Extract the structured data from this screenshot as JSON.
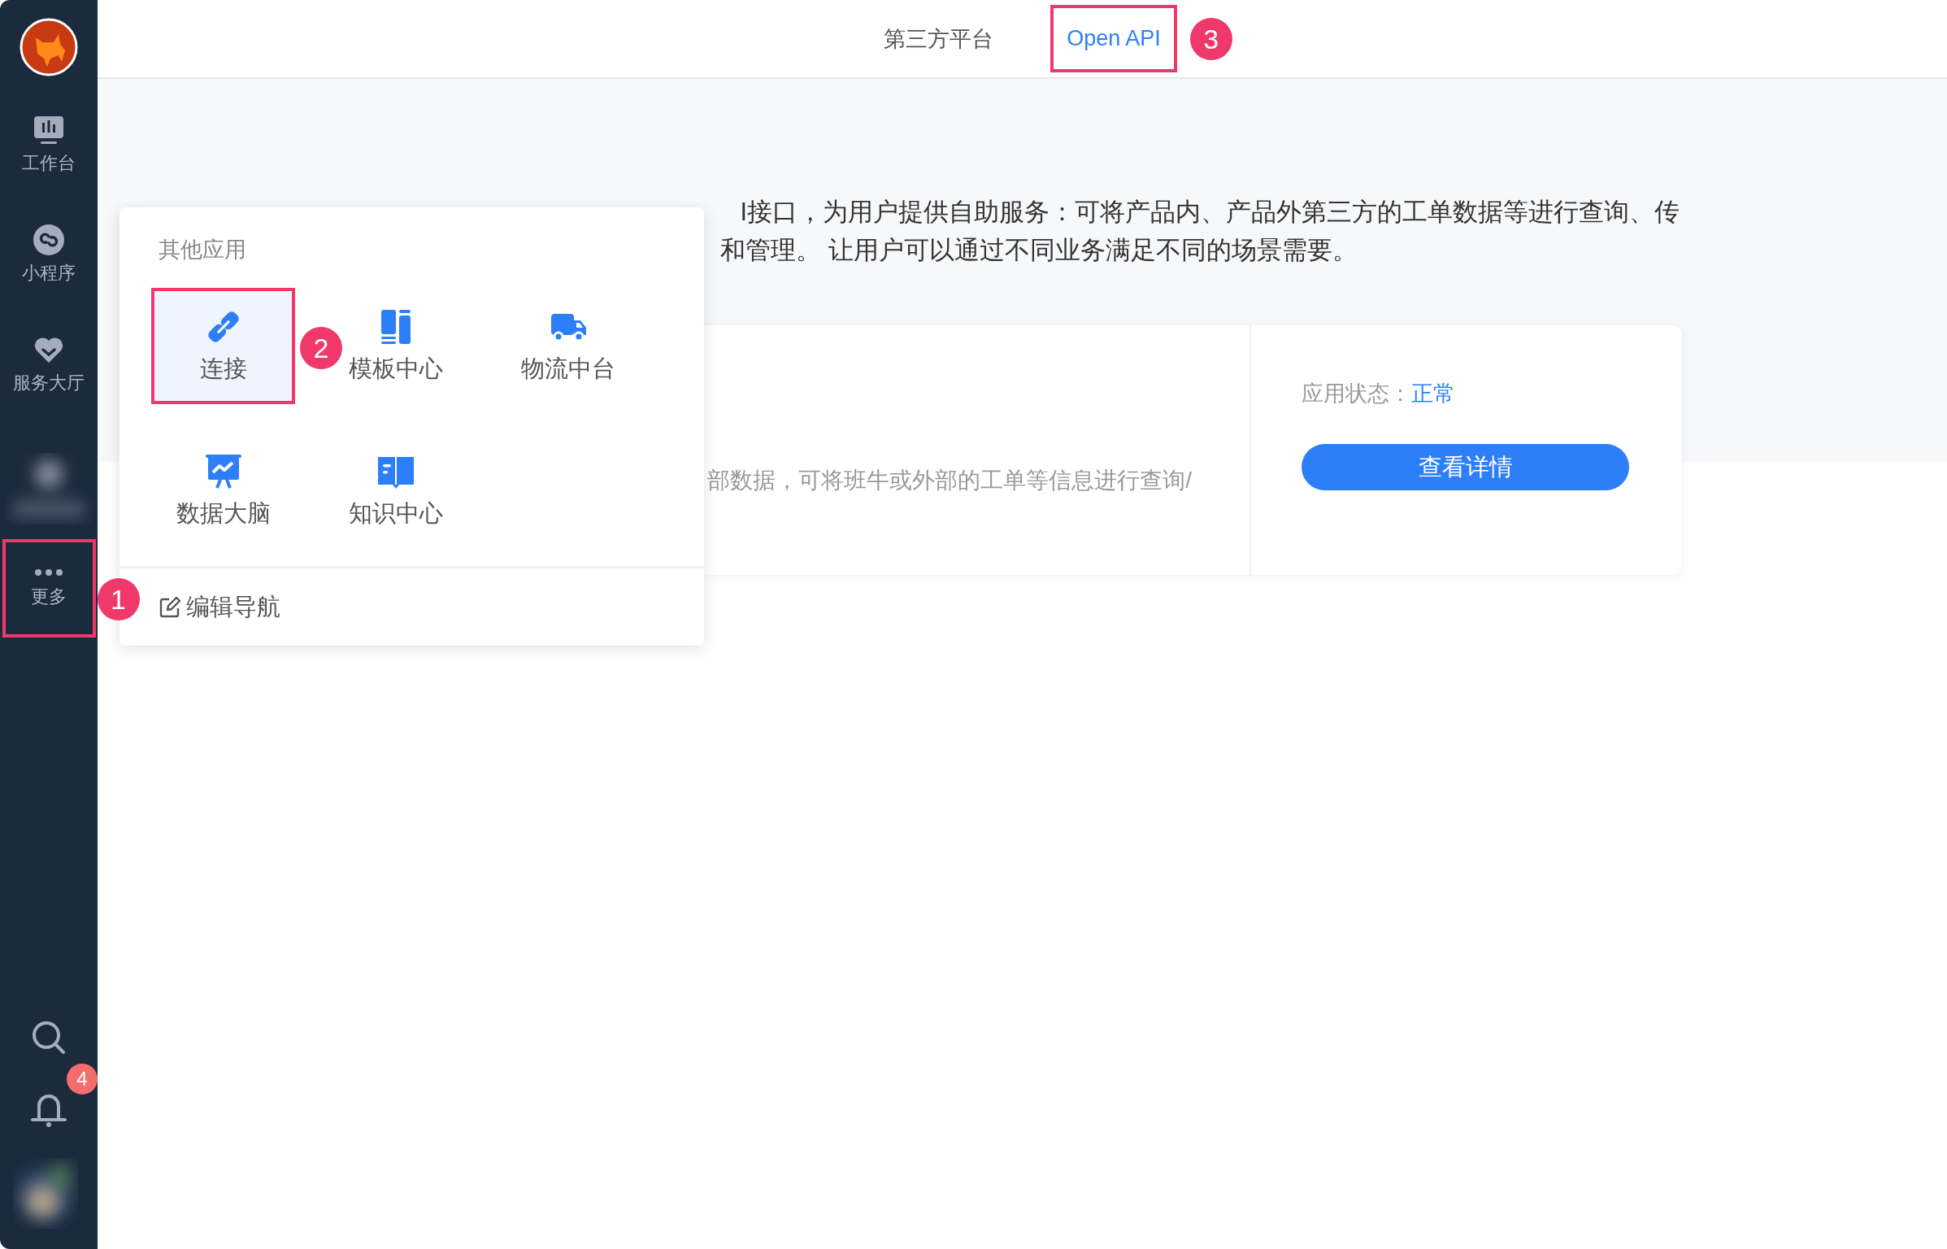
{
  "sidebar": {
    "nav": [
      {
        "label": "工作台"
      },
      {
        "label": "小程序"
      },
      {
        "label": "服务大厅"
      }
    ],
    "more": {
      "label": "更多",
      "callout": "1",
      "highlighted": true
    },
    "notifications": {
      "badge": "4"
    }
  },
  "tabs": [
    {
      "label": "第三方平台",
      "selected": false,
      "highlighted": false
    },
    {
      "label": "Open API",
      "selected": true,
      "highlighted": true,
      "callout": "3"
    }
  ],
  "description": [
    "I接口，为用户提供自助服务：可将产品内、产品外第三方的工单数据等进行查询、传",
    "和管理。 让用户可以通过不同业务满足不同的场景需要。"
  ],
  "card": {
    "description": "部数据，可将班牛或外部的工单等信息进行查询/",
    "status_label": "应用状态：",
    "status_value": "正常",
    "button": "查看详情"
  },
  "popup": {
    "title": "其他应用",
    "apps": [
      {
        "label": "连接",
        "selected": true,
        "highlighted": true,
        "callout": "2"
      },
      {
        "label": "模板中心",
        "selected": false,
        "highlighted": false
      },
      {
        "label": "物流中台",
        "selected": false,
        "highlighted": false
      },
      {
        "label": "数据大脑",
        "selected": false,
        "highlighted": false
      },
      {
        "label": "知识中心",
        "selected": false,
        "highlighted": false
      }
    ],
    "footer": "编辑导航"
  }
}
